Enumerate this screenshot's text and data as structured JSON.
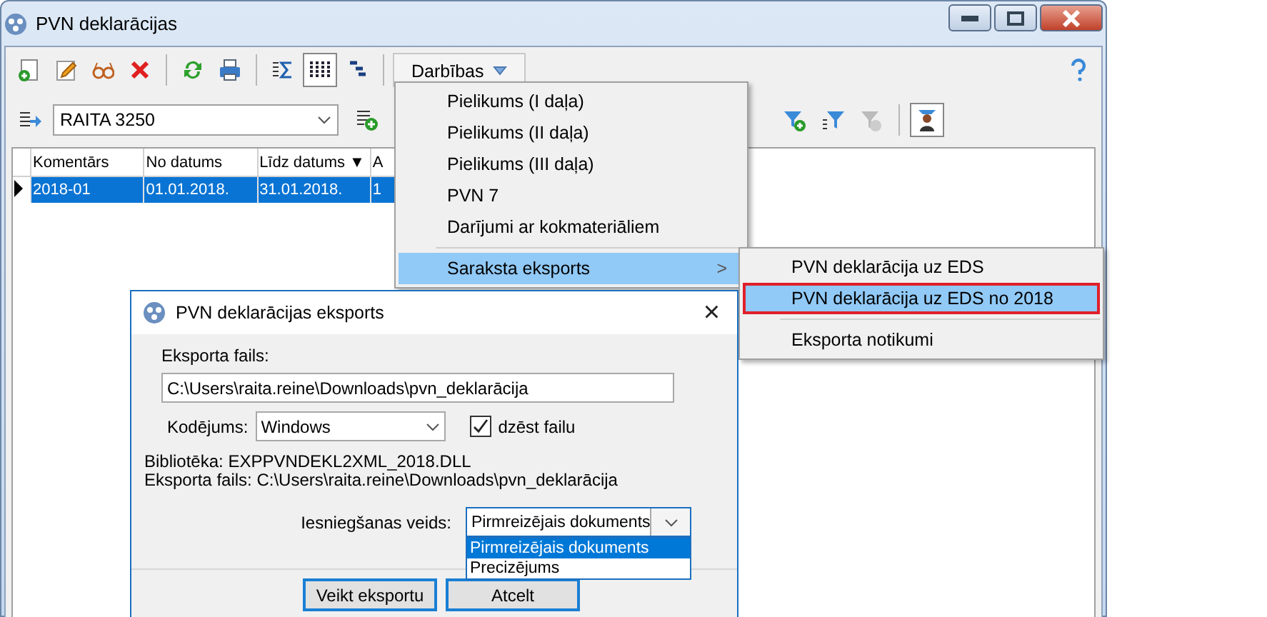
{
  "window": {
    "title": "PVN deklarācijas"
  },
  "toolbar": {
    "buttons": [
      {
        "kind": "new",
        "pressed": false
      },
      {
        "kind": "edit",
        "pressed": false
      },
      {
        "kind": "view",
        "pressed": false
      },
      {
        "kind": "delete",
        "pressed": false
      },
      {
        "kind": "sep"
      },
      {
        "kind": "refresh",
        "pressed": false
      },
      {
        "kind": "print",
        "pressed": false
      },
      {
        "kind": "sep"
      },
      {
        "kind": "sum",
        "pressed": false
      },
      {
        "kind": "columns",
        "pressed": true
      },
      {
        "kind": "tree",
        "pressed": false
      },
      {
        "kind": "sep"
      }
    ],
    "actions_button": "Darbības"
  },
  "filter_bar": {
    "combo_value": "RAITA 3250",
    "buttons": [
      {
        "kind": "filter-add",
        "pressed": false
      },
      {
        "kind": "filter-list",
        "pressed": false
      },
      {
        "kind": "filter-off",
        "pressed": false
      },
      {
        "kind": "sep"
      },
      {
        "kind": "filter-person",
        "pressed": true
      }
    ]
  },
  "table": {
    "columns": [
      "Komentārs",
      "No datums",
      "Līdz datums ▼",
      "A"
    ],
    "rows": [
      {
        "selected": true,
        "cells": [
          "2018-01",
          "01.01.2018.",
          "31.01.2018.",
          "1"
        ]
      }
    ]
  },
  "actions_menu": {
    "items": [
      {
        "kind": "item",
        "label": "Pielikums (I daļa)",
        "highlighted": false
      },
      {
        "kind": "item",
        "label": "Pielikums (II daļa)",
        "highlighted": false
      },
      {
        "kind": "item",
        "label": "Pielikums (III daļa)",
        "highlighted": false
      },
      {
        "kind": "item",
        "label": "PVN 7",
        "highlighted": false
      },
      {
        "kind": "item",
        "label": "Darījumi ar kokmateriāliem",
        "highlighted": false
      },
      {
        "kind": "separator"
      },
      {
        "kind": "item",
        "label": "Saraksta eksports",
        "highlighted": true,
        "submenu": true,
        "submenu_arrow": ">"
      }
    ]
  },
  "submenu": {
    "items": [
      {
        "kind": "item",
        "label": "PVN deklarācija uz EDS",
        "selected": false
      },
      {
        "kind": "item",
        "label": "PVN deklarācija uz EDS no 2018",
        "selected": true
      },
      {
        "kind": "separator"
      },
      {
        "kind": "item",
        "label": "Eksporta notikumi",
        "selected": false
      }
    ]
  },
  "dialog": {
    "title": "PVN deklarācijas eksports",
    "close": "×",
    "file_label": "Eksporta fails:",
    "file_value": "C:\\Users\\raita.reine\\Downloads\\pvn_deklarācija",
    "encoding_label": "Kodējums:",
    "encoding_value": "Windows",
    "delete_file": {
      "label": "dzēst failu",
      "checked": true
    },
    "info_lines": [
      "Bibliotēka: EXPPVNDEKL2XML_2018.DLL",
      "Eksporta fails: C:\\Users\\raita.reine\\Downloads\\pvn_deklarācija"
    ],
    "submission": {
      "label": "Iesniegšanas veids:",
      "value": "Pirmreizējais dokuments",
      "options": [
        {
          "label": "Pirmreizējais dokuments",
          "selected": true
        },
        {
          "label": "Precizējums",
          "selected": false
        }
      ]
    },
    "buttons": [
      "Veikt eksportu",
      "Atcelt"
    ]
  }
}
